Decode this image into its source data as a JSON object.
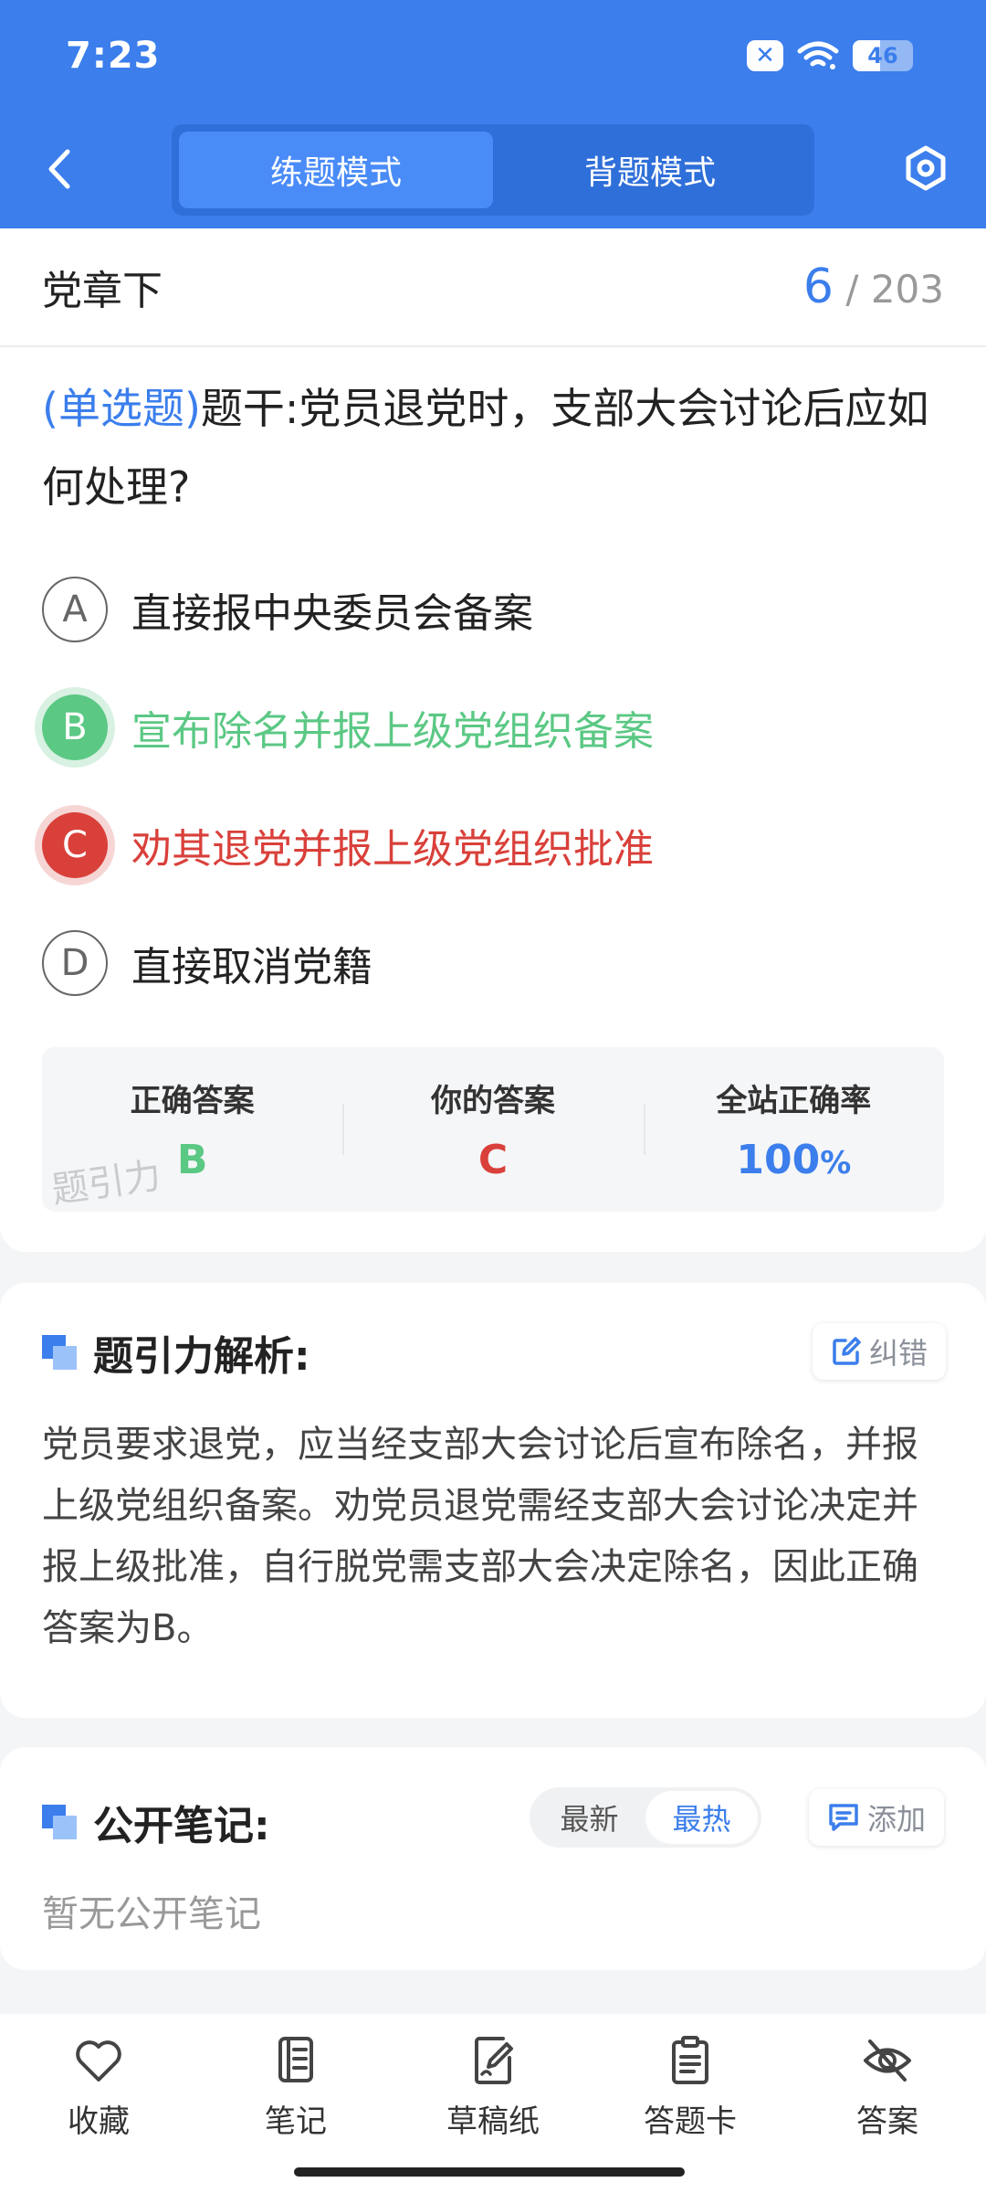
{
  "status_bar": {
    "time": "7:23",
    "battery": "46",
    "battery_level": 0.46
  },
  "header": {
    "tabs": [
      {
        "label": "练题模式",
        "active": true
      },
      {
        "label": "背题模式",
        "active": false
      }
    ],
    "icons": {
      "back": "chevron-left-icon",
      "settings": "hexagon-settings-icon"
    }
  },
  "chapter": {
    "title": "党章下",
    "current": "6",
    "separator": "/",
    "total": "203"
  },
  "question": {
    "type": "(单选题)",
    "stem": "题干:党员退党时，支部大会讨论后应如何处理?"
  },
  "options": [
    {
      "letter": "A",
      "text": "直接报中央委员会备案",
      "state": "normal"
    },
    {
      "letter": "B",
      "text": "宣布除名并报上级党组织备案",
      "state": "correct"
    },
    {
      "letter": "C",
      "text": "劝其退党并报上级党组织批准",
      "state": "wrong"
    },
    {
      "letter": "D",
      "text": "直接取消党籍",
      "state": "normal"
    }
  ],
  "answer_summary": {
    "correct_label": "正确答案",
    "correct_value": "B",
    "yours_label": "你的答案",
    "yours_value": "C",
    "rate_label": "全站正确率",
    "rate_value": "100",
    "rate_unit": "%",
    "watermark": "题引力"
  },
  "analysis": {
    "title": "题引力解析:",
    "report_label": "纠错",
    "text": "党员要求退党，应当经支部大会讨论后宣布除名，并报上级党组织备案。劝党员退党需经支部大会讨论决定并报上级批准，自行脱党需支部大会决定除名，因此正确答案为B。"
  },
  "notes": {
    "title": "公开笔记:",
    "sort_options": [
      {
        "label": "最新",
        "active": false
      },
      {
        "label": "最热",
        "active": true
      }
    ],
    "add_label": "添加",
    "empty_text": "暂无公开笔记"
  },
  "bottom_nav": [
    {
      "label": "收藏",
      "icon": "heart-icon"
    },
    {
      "label": "笔记",
      "icon": "notebook-icon"
    },
    {
      "label": "草稿纸",
      "icon": "draft-paper-icon"
    },
    {
      "label": "答题卡",
      "icon": "answer-card-icon"
    },
    {
      "label": "答案",
      "icon": "eye-off-icon"
    }
  ],
  "colors": {
    "primary": "#3b7eec",
    "correct": "#5bc884",
    "wrong": "#d9403a"
  }
}
